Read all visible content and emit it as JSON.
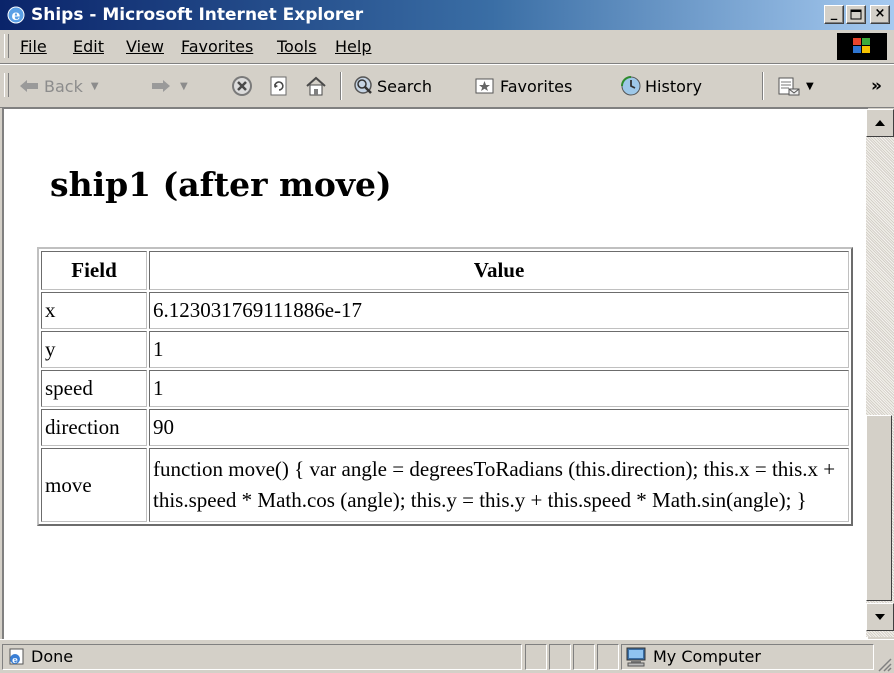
{
  "window": {
    "title": "Ships - Microsoft Internet Explorer",
    "min_glyph": "_",
    "close_glyph": "×",
    "title_color": "#0a246a"
  },
  "menu": {
    "file": "File",
    "edit": "Edit",
    "view": "View",
    "favorites": "Favorites",
    "tools": "Tools",
    "help": "Help"
  },
  "toolbar": {
    "back": "Back",
    "search": "Search",
    "favorites": "Favorites",
    "history": "History",
    "more": "»"
  },
  "page": {
    "heading": "ship1 (after move)",
    "table": {
      "headers": [
        "Field",
        "Value"
      ],
      "rows": [
        {
          "field": "x",
          "value": "6.123031769111886e-17"
        },
        {
          "field": "y",
          "value": "1"
        },
        {
          "field": "speed",
          "value": "1"
        },
        {
          "field": "direction",
          "value": "90"
        },
        {
          "field": "move",
          "value": "function move() { var angle = degreesToRadians (this.direction); this.x = this.x + this.speed * Math.cos (angle); this.y = this.y + this.speed * Math.sin(angle); }"
        }
      ]
    }
  },
  "status": {
    "text": "Done",
    "zone": "My Computer"
  }
}
